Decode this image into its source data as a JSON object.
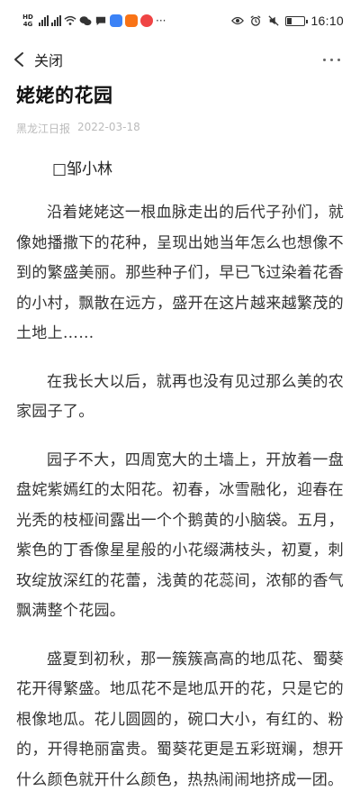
{
  "status_bar": {
    "network_badge": "HD",
    "network_type": "4G",
    "time": "16:10",
    "icons": [
      "signal-icon",
      "wifi-icon",
      "wechat-icon",
      "message-icon",
      "app-icon",
      "app-icon",
      "more-icon",
      "eye-icon",
      "alarm-icon",
      "mute-icon",
      "battery-icon"
    ]
  },
  "nav": {
    "back_label": "关闭",
    "back_icon": "chevron-left-icon",
    "more_icon": "more-dots-icon"
  },
  "article": {
    "title": "姥姥的花园",
    "source": "黑龙江日报",
    "date": "2022-03-18",
    "author": "□邹小林",
    "paragraphs": [
      "沿着姥姥这一根血脉走出的后代子孙们，就像她播撒下的花种，呈现出她当年怎么也想像不到的繁盛美丽。那些种子们，早已飞过染着花香的小村，飘散在远方，盛开在这片越来越繁茂的土地上……",
      "在我长大以后，就再也没有见过那么美的农家园子了。",
      "园子不大，四周宽大的土墙上，开放着一盘盘姹紫嫣红的太阳花。初春，冰雪融化，迎春在光秃的枝桠间露出一个个鹅黄的小脑袋。五月，紫色的丁香像星星般的小花缀满枝头，初夏，刺玫绽放深红的花蕾，浅黄的花蕊间，浓郁的香气飘满整个花园。",
      "盛夏到初秋，那一簇簇高高的地瓜花、蜀葵花开得繁盛。地瓜花不是地瓜开的花，只是它的根像地瓜。花儿圆圆的，碗口大小，有红的、粉的，开得艳丽富贵。蜀葵花更是五彩斑斓，想开什么颜色就开什么颜色，热热闹闹地挤成一团。"
    ]
  },
  "colors": {
    "text": "#333333",
    "meta": "#bbbbbb",
    "background": "#ffffff"
  }
}
